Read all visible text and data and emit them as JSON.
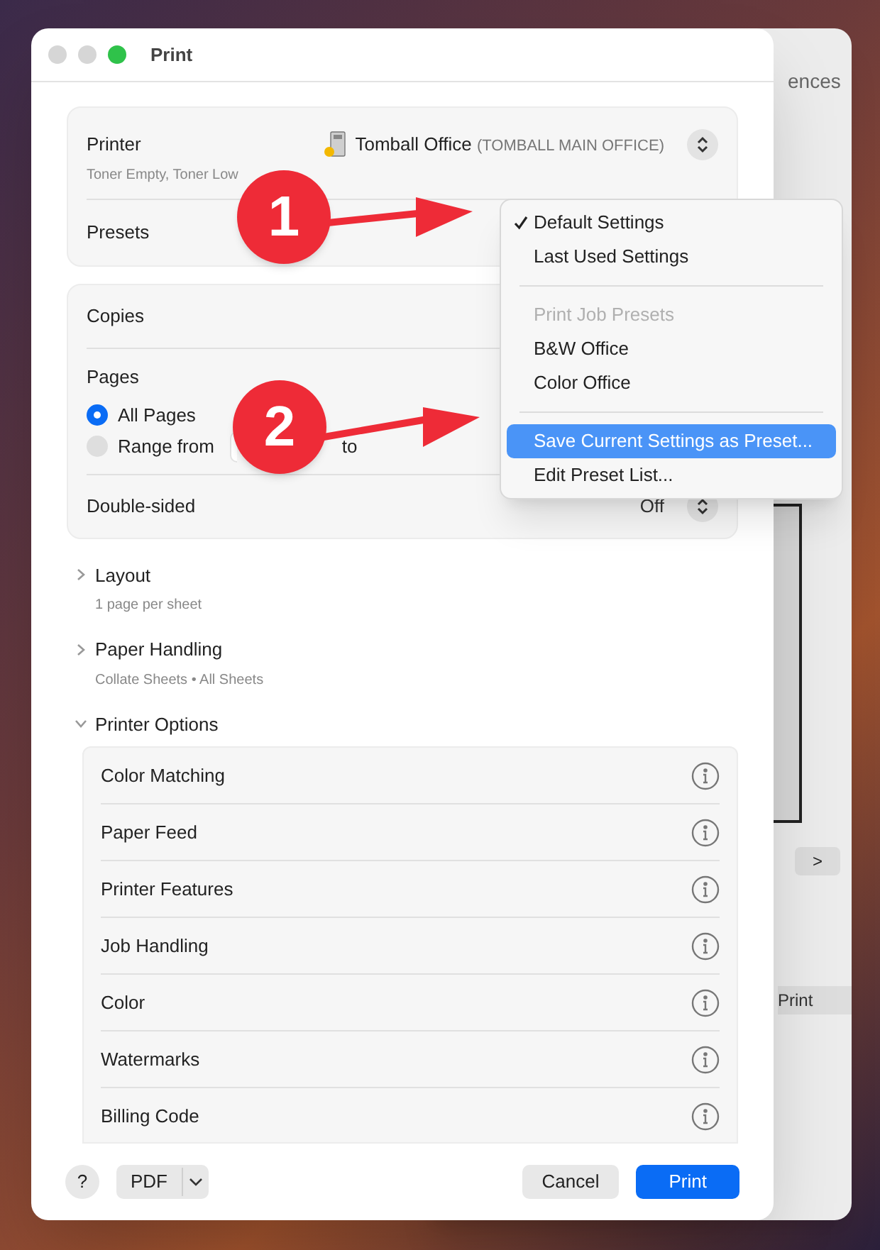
{
  "window": {
    "title": "Print"
  },
  "printer": {
    "label": "Printer",
    "status": "Toner Empty, Toner Low",
    "name": "Tomball Office",
    "model": "(TOMBALL MAIN OFFICE)"
  },
  "presets": {
    "label": "Presets"
  },
  "copies": {
    "label": "Copies"
  },
  "pages": {
    "label": "Pages",
    "options": [
      {
        "label": "All Pages",
        "selected": true
      },
      {
        "label": "Range from",
        "selected": false
      }
    ],
    "to_label": "to"
  },
  "double_sided": {
    "label": "Double-sided",
    "value": "Off"
  },
  "sections": [
    {
      "title": "Layout",
      "subtitle": "1 page per sheet",
      "expanded": false
    },
    {
      "title": "Paper Handling",
      "subtitle": "Collate Sheets • All Sheets",
      "expanded": false
    },
    {
      "title": "Printer Options",
      "expanded": true
    }
  ],
  "printer_options": [
    "Color Matching",
    "Paper Feed",
    "Printer Features",
    "Job Handling",
    "Color",
    "Watermarks",
    "Billing Code"
  ],
  "footer": {
    "help": "?",
    "pdf": "PDF",
    "cancel": "Cancel",
    "print": "Print"
  },
  "presets_menu": [
    {
      "kind": "item",
      "label": "Default Settings",
      "checked": true,
      "highlighted": false
    },
    {
      "kind": "item",
      "label": "Last Used Settings",
      "checked": false,
      "highlighted": false
    },
    {
      "kind": "separator"
    },
    {
      "kind": "header",
      "label": "Print Job Presets"
    },
    {
      "kind": "item",
      "label": "B&W Office",
      "checked": false,
      "highlighted": false
    },
    {
      "kind": "item",
      "label": "Color Office",
      "checked": false,
      "highlighted": false
    },
    {
      "kind": "separator"
    },
    {
      "kind": "item",
      "label": "Save Current Settings as Preset...",
      "checked": false,
      "highlighted": true
    },
    {
      "kind": "item",
      "label": "Edit Preset List...",
      "checked": false,
      "highlighted": false
    }
  ],
  "callouts": [
    {
      "number": "1"
    },
    {
      "number": "2"
    }
  ],
  "background_window": {
    "title_fragment": "ences",
    "next": ">",
    "print_label": "Print"
  }
}
